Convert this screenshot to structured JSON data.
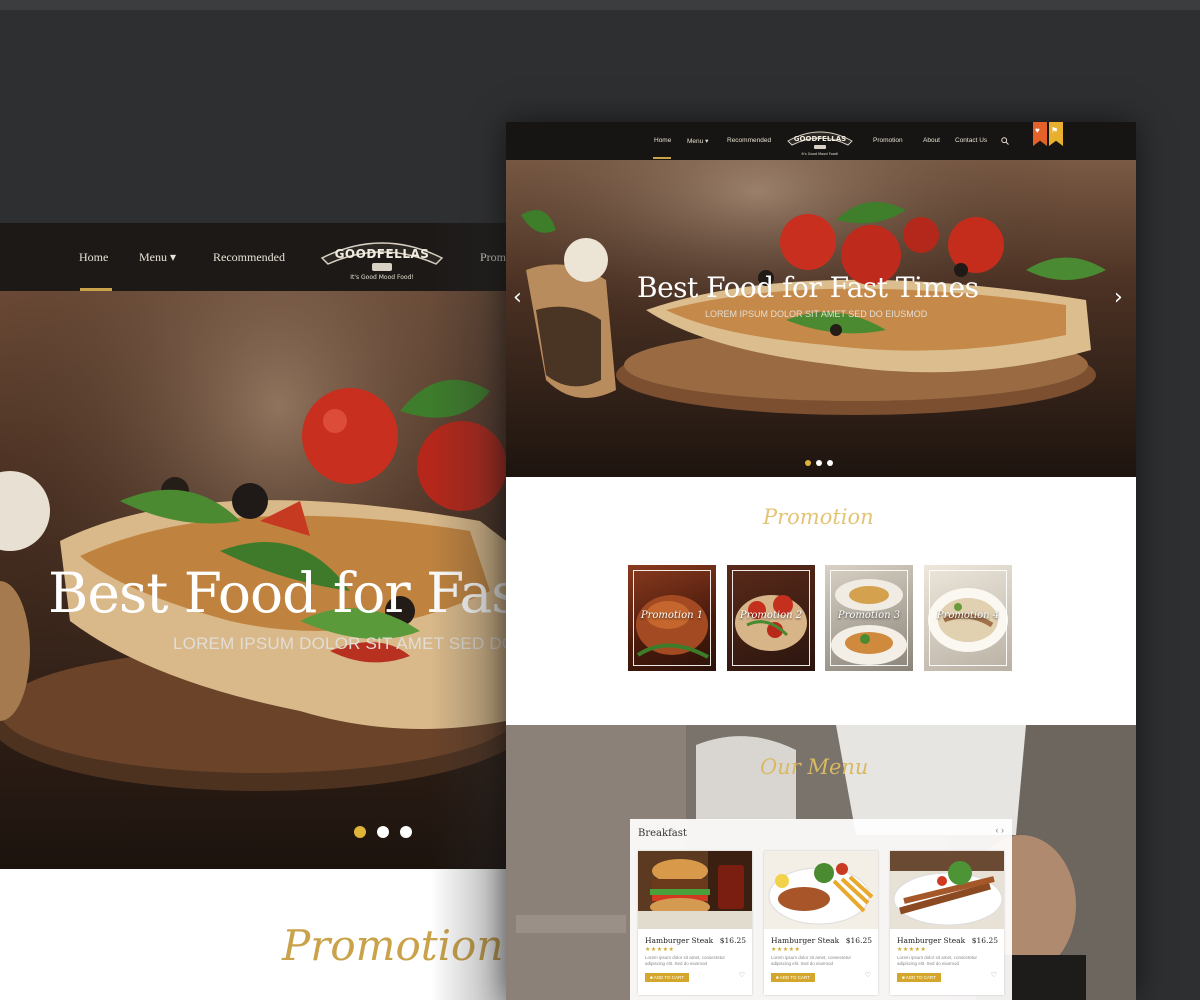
{
  "brand": {
    "name": "GOODFELLAS",
    "tagline": "It's Good Mood Food!"
  },
  "nav": {
    "home": "Home",
    "menu": "Menu",
    "recommended": "Recommended",
    "promotion": "Promotion",
    "about": "About",
    "contact": "Contact Us",
    "left_partial": "Prom"
  },
  "hero": {
    "title": "Best Food for Fast Times",
    "subtitle": "LOREM IPSUM DOLOR SIT AMET SED DO EIUSMOD",
    "title_left_crop": "Best Food for Fas",
    "subtitle_left_crop": "LOREM IPSUM DOLOR SIT AMET SED DO"
  },
  "promotion": {
    "heading": "Promotion",
    "tiles": [
      "Promotion 1",
      "Promotion 2",
      "Promotion 3",
      "Promotion 4"
    ]
  },
  "our_menu": {
    "heading": "Our Menu",
    "category": "Breakfast",
    "items": [
      {
        "name": "Hamburger Steak",
        "price": "$16.25",
        "stars": "★★★★★",
        "desc": "Lorem ipsum dolor sit amet, consectetur adipiscing elit. Sed do eiusmod",
        "cart": "■ ADD TO CART"
      },
      {
        "name": "Hamburger Steak",
        "price": "$16.25",
        "stars": "★★★★★",
        "desc": "Lorem ipsum dolor sit amet, consectetur adipiscing elit. Sed do eiusmod",
        "cart": "■ ADD TO CART"
      },
      {
        "name": "Hamburger Steak",
        "price": "$16.25",
        "stars": "★★★★★",
        "desc": "Lorem ipsum dolor sit amet, consectetur adipiscing elit. Sed do eiusmod",
        "cart": "■ ADD TO CART"
      }
    ]
  },
  "icons": {
    "search": "search-icon",
    "heart": "heart-icon",
    "prev": "chevron-left-icon",
    "next": "chevron-right-icon"
  },
  "colors": {
    "accent": "#c9a24a",
    "dark_nav": "#171513",
    "page_bg": "#2e2f31",
    "ribbon_orange": "#e4622a",
    "ribbon_yellow": "#e7b12f"
  }
}
